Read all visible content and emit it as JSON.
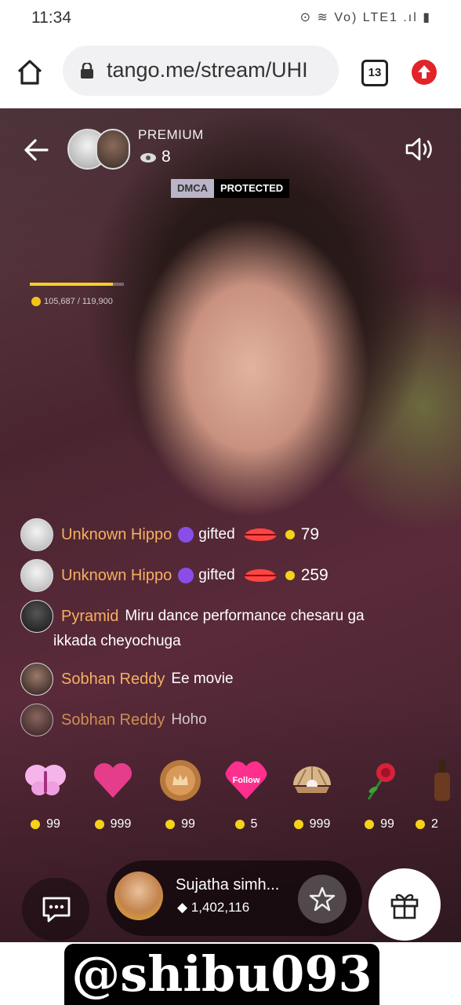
{
  "status_bar": {
    "time": "11:34",
    "icons": "⊙ ≋ Vo) LTE1 .ıl ▮"
  },
  "browser": {
    "url": "tango.me/stream/UHI",
    "tab_count": "13"
  },
  "stream": {
    "label": "PREMIUM",
    "viewers": "8",
    "dmca": "DMCA",
    "protected": "PROTECTED",
    "goal_text": "105,687 / 119,900",
    "goal_progress": 0.88,
    "chat": [
      {
        "name": "Unknown Hippo",
        "text": "gifted",
        "amount": "79"
      },
      {
        "name": "Unknown Hippo",
        "text": "gifted",
        "amount": "259"
      },
      {
        "name": "Pyramid",
        "text": "Miru dance performance chesaru ga",
        "text2": "ikkada cheyochuga"
      },
      {
        "name": "Sobhan Reddy",
        "text": "Ee movie"
      },
      {
        "name": "Sobhan Reddy",
        "text": "Hoho"
      }
    ],
    "gifts": [
      {
        "name": "butterfly",
        "price": "99",
        "color": "#f2a8e6"
      },
      {
        "name": "heart",
        "price": "999",
        "color": "#e63c8c"
      },
      {
        "name": "crown-coin",
        "price": "99",
        "color": "#c08a4a"
      },
      {
        "name": "follow",
        "price": "5",
        "color": "#ff2f8e",
        "label": "Follow"
      },
      {
        "name": "pearl-shell",
        "price": "999",
        "color": "#d9b58a"
      },
      {
        "name": "rose",
        "price": "99",
        "color": "#d8223a"
      },
      {
        "name": "bottle",
        "price": "2",
        "color": "#6a3b1e"
      }
    ],
    "host": {
      "name": "Sujatha simh...",
      "diamonds": "1,402,116"
    }
  },
  "watermark": "@shibu093"
}
